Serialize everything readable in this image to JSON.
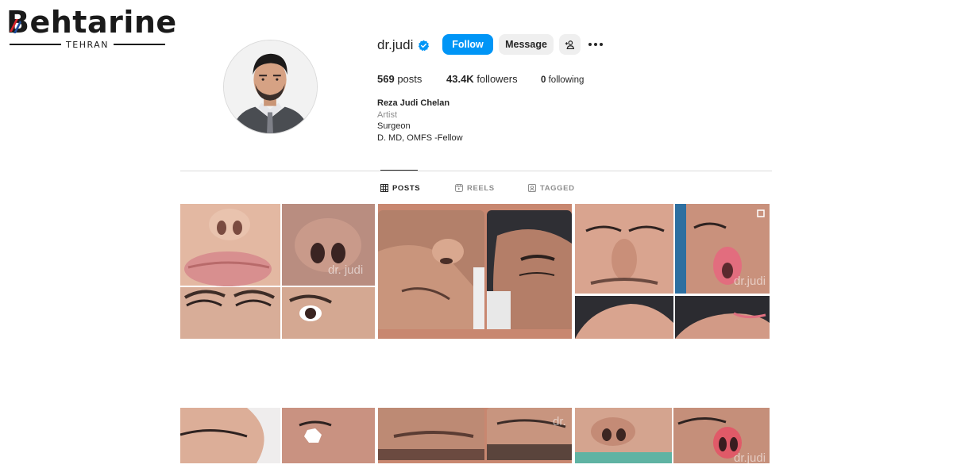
{
  "watermark": {
    "brand": "Behtarine",
    "city": "TEHRAN"
  },
  "profile": {
    "username": "dr.judi",
    "verified": true,
    "follow_label": "Follow",
    "message_label": "Message",
    "add_user_icon": "person-plus-icon",
    "more_icon": "more-horizontal-icon",
    "posts_count": "569",
    "posts_label": "posts",
    "followers_count": "43.4K",
    "followers_label": "followers",
    "following_count": "0",
    "following_label": "following",
    "full_name": "Reza Judi Chelan",
    "category": "Artist",
    "bio_lines": [
      "Surgeon",
      "D. MD, OMFS -Fellow"
    ]
  },
  "tabs": [
    {
      "label": "POSTS",
      "icon": "grid-icon",
      "active": true
    },
    {
      "label": "REELS",
      "icon": "reels-icon",
      "active": false
    },
    {
      "label": "TAGGED",
      "icon": "tagged-icon",
      "active": false
    }
  ],
  "posts": [
    {
      "watermark": "dr. judi",
      "multi": false
    },
    {
      "watermark": "",
      "multi": false
    },
    {
      "watermark": "dr.judi",
      "multi": true
    },
    {
      "watermark": "",
      "multi": false
    },
    {
      "watermark": "dr.",
      "multi": false
    },
    {
      "watermark": "dr.judi",
      "multi": false
    }
  ],
  "colors": {
    "accent": "#0095f6",
    "text": "#262626",
    "muted": "#8e8e8e",
    "divider": "#dbdbdb",
    "button_gray": "#efefef"
  }
}
